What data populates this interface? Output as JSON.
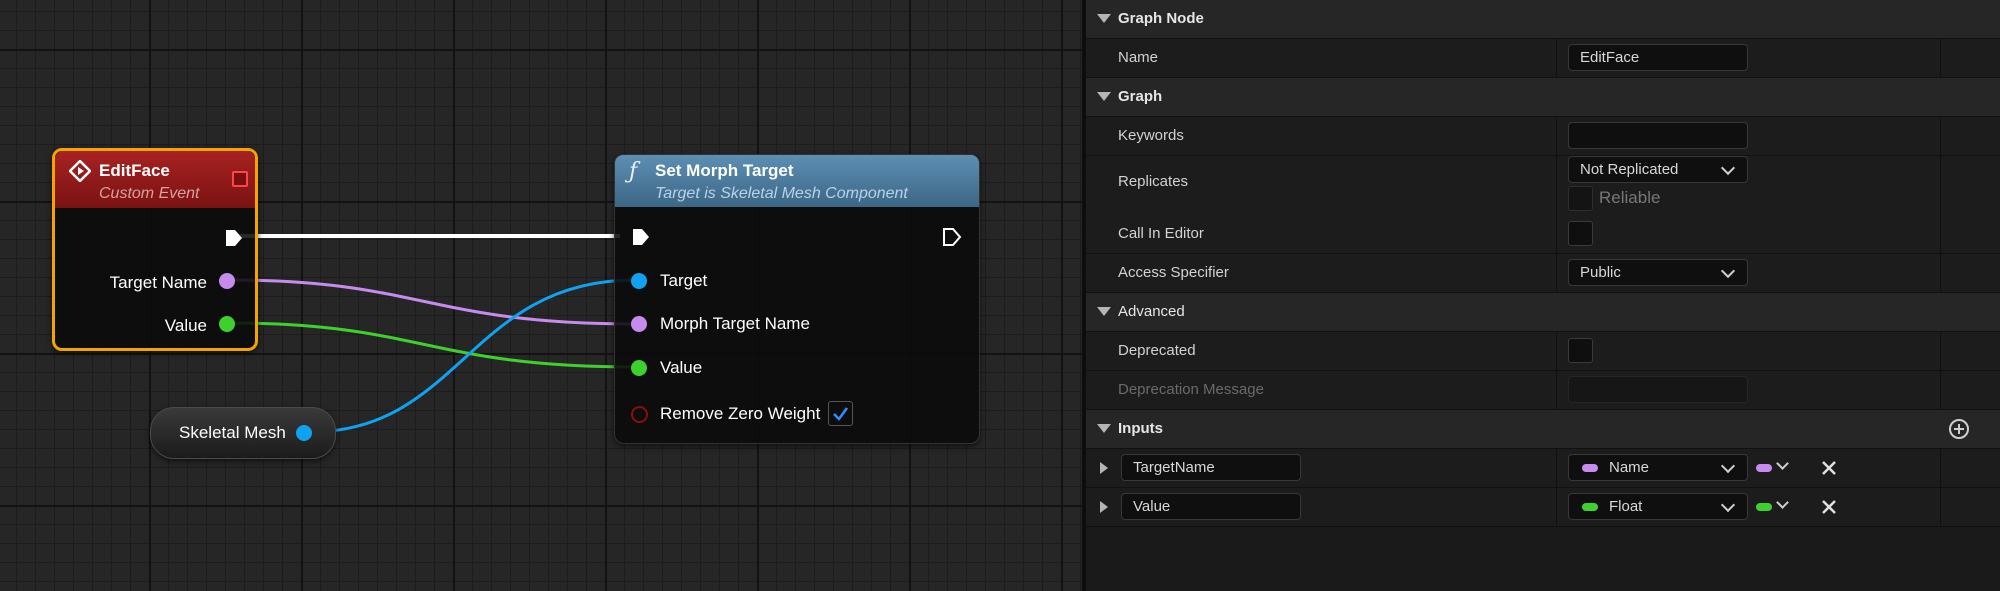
{
  "graph": {
    "custom_event_node": {
      "title": "EditFace",
      "subtitle": "Custom Event",
      "pins": {
        "target_name": "Target Name",
        "value": "Value"
      }
    },
    "function_node": {
      "title": "Set Morph Target",
      "subtitle": "Target is Skeletal Mesh Component",
      "pins": {
        "target": "Target",
        "morph_target_name": "Morph Target Name",
        "value": "Value",
        "remove_zero_weight": "Remove Zero Weight"
      },
      "remove_zero_weight_checked": true
    },
    "variable_node": {
      "label": "Skeletal Mesh"
    },
    "colors": {
      "exec": "#ffffff",
      "name_pin": "#c78bee",
      "float_pin": "#3ed12e",
      "object_pin": "#10a2f0",
      "bool_pin": "#8c0d0d",
      "event_header": "#9b1c1c",
      "function_header": "#4c7fa3",
      "selection": "#f5a300"
    }
  },
  "details": {
    "graph_node": {
      "category": "Graph Node",
      "name_label": "Name",
      "name_value": "EditFace"
    },
    "graph": {
      "category": "Graph",
      "keywords_label": "Keywords",
      "keywords_value": "",
      "replicates_label": "Replicates",
      "replicates_value": "Not Replicated",
      "reliable_label": "Reliable",
      "call_in_editor_label": "Call In Editor",
      "access_specifier_label": "Access Specifier",
      "access_specifier_value": "Public"
    },
    "advanced": {
      "category": "Advanced",
      "deprecated_label": "Deprecated",
      "deprecation_message_label": "Deprecation Message"
    },
    "inputs": {
      "category": "Inputs",
      "items": [
        {
          "name": "TargetName",
          "type": "Name",
          "color": "#c78bee"
        },
        {
          "name": "Value",
          "type": "Float",
          "color": "#3ed12e"
        }
      ]
    }
  }
}
